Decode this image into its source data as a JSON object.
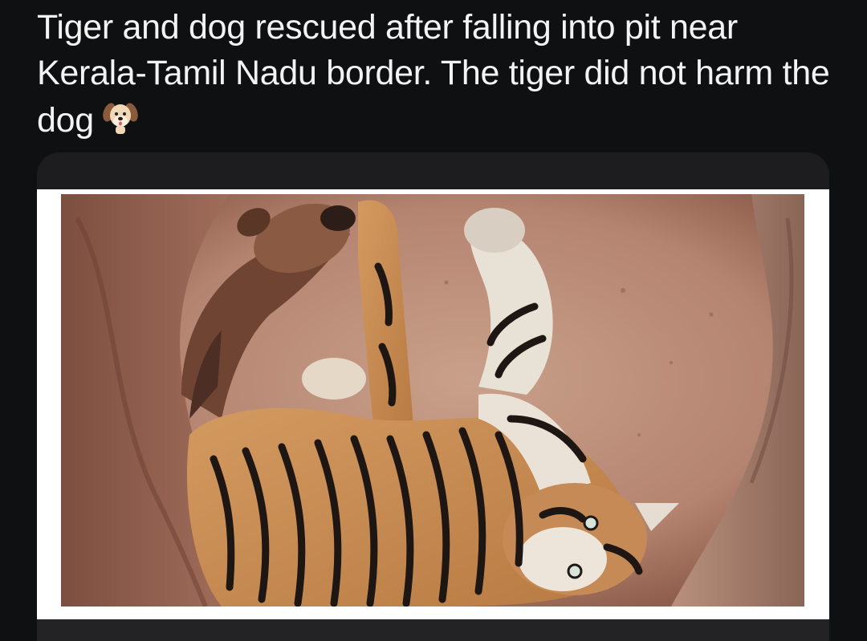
{
  "post": {
    "text": "Tiger and dog rescued after falling into pit near Kerala-Tamil Nadu border. The tiger did not harm the dog",
    "emoji": "dog-face-emoji"
  },
  "media": {
    "icons": {
      "dog": "dog-figure",
      "tiger": "tiger-figure"
    },
    "colors": {
      "background": "#0f1011",
      "frame": "#ffffff",
      "soil": "#b58670",
      "tiger_orange": "#c98a4f",
      "dog_brown": "#7a4f3a"
    }
  }
}
